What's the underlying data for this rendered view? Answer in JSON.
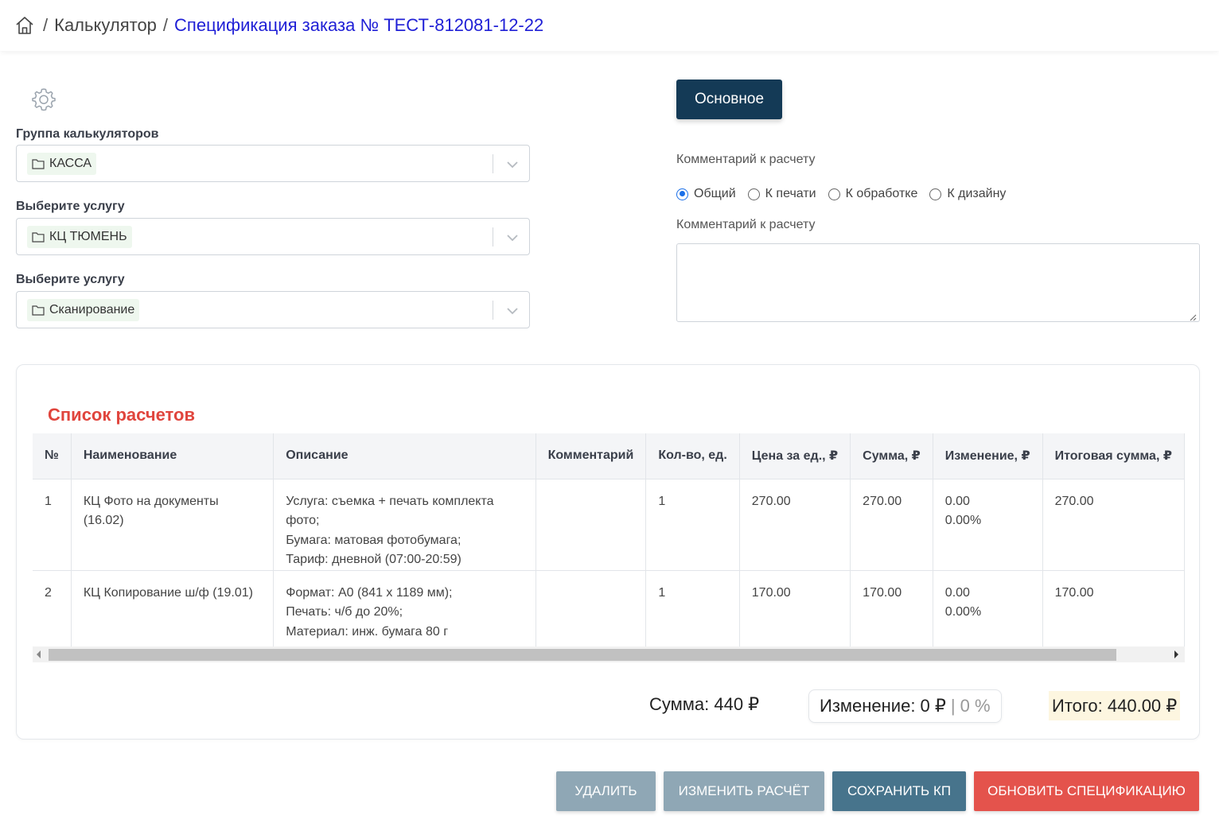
{
  "breadcrumb": {
    "items": [
      "Калькулятор",
      "Спецификация заказа № ТЕСТ-812081-12-22"
    ],
    "separator": "/"
  },
  "form": {
    "group_label": "Группа калькуляторов",
    "group_value": "КАССА",
    "service1_label": "Выберите услугу",
    "service1_value": "КЦ ТЮМЕНЬ",
    "service2_label": "Выберите услугу",
    "service2_value": "Сканирование"
  },
  "tab": {
    "label": "Основное",
    "color": "#143a56"
  },
  "comment": {
    "section_label": "Комментарий к расчету",
    "radios": [
      {
        "label": "Общий",
        "checked": true
      },
      {
        "label": "К печати",
        "checked": false
      },
      {
        "label": "К обработке",
        "checked": false
      },
      {
        "label": "К дизайну",
        "checked": false
      }
    ],
    "field_label": "Комментарий к расчету",
    "value": ""
  },
  "calc_list": {
    "title": "Список расчетов",
    "title_color": "#e0453d",
    "columns": [
      "№",
      "Наименование",
      "Описание",
      "Комментарий",
      "Кол-во, ед.",
      "Цена за ед., ₽",
      "Сумма, ₽",
      "Изменение, ₽",
      "Итоговая сумма, ₽"
    ],
    "rows": [
      {
        "num": "1",
        "name": "КЦ Фото на документы (16.02)",
        "desc": [
          "Услуга: съемка + печать комплекта фото;",
          "Бумага: матовая фотобумага;",
          "Тариф: дневной (07:00-20:59)"
        ],
        "comment": "",
        "qty": "1",
        "price": "270.00",
        "sum": "270.00",
        "change": "0.00",
        "change_pct": "0.00%",
        "total": "270.00"
      },
      {
        "num": "2",
        "name": "КЦ Копирование ш/ф (19.01)",
        "desc": [
          "Формат: А0 (841 x 1189 мм);",
          "Печать: ч/б до 20%;",
          "Материал: инж. бумага 80 г"
        ],
        "comment": "",
        "qty": "1",
        "price": "170.00",
        "sum": "170.00",
        "change": "0.00",
        "change_pct": "0.00%",
        "total": "170.00"
      }
    ]
  },
  "totals": {
    "sum": "Сумма: 440 ₽",
    "change": "Изменение: 0 ₽",
    "change_sep": "|",
    "change_pct": "0 %",
    "total": "Итого: 440.00 ₽"
  },
  "actions": {
    "delete": "УДАЛИТЬ",
    "edit": "ИЗМЕНИТЬ РАСЧЁТ",
    "save": "СОХРАНИТЬ КП",
    "update": "ОБНОВИТЬ СПЕЦИФИКАЦИЮ"
  },
  "icons": [
    "home-icon",
    "gear-icon",
    "folder-icon",
    "chevron-down-icon"
  ],
  "colors": {
    "accent_blue": "#1f1fd6",
    "radio_blue": "#1a6fe8",
    "danger": "#e4534c",
    "save": "#47748c",
    "muted_btn": "#8fa7b5"
  }
}
